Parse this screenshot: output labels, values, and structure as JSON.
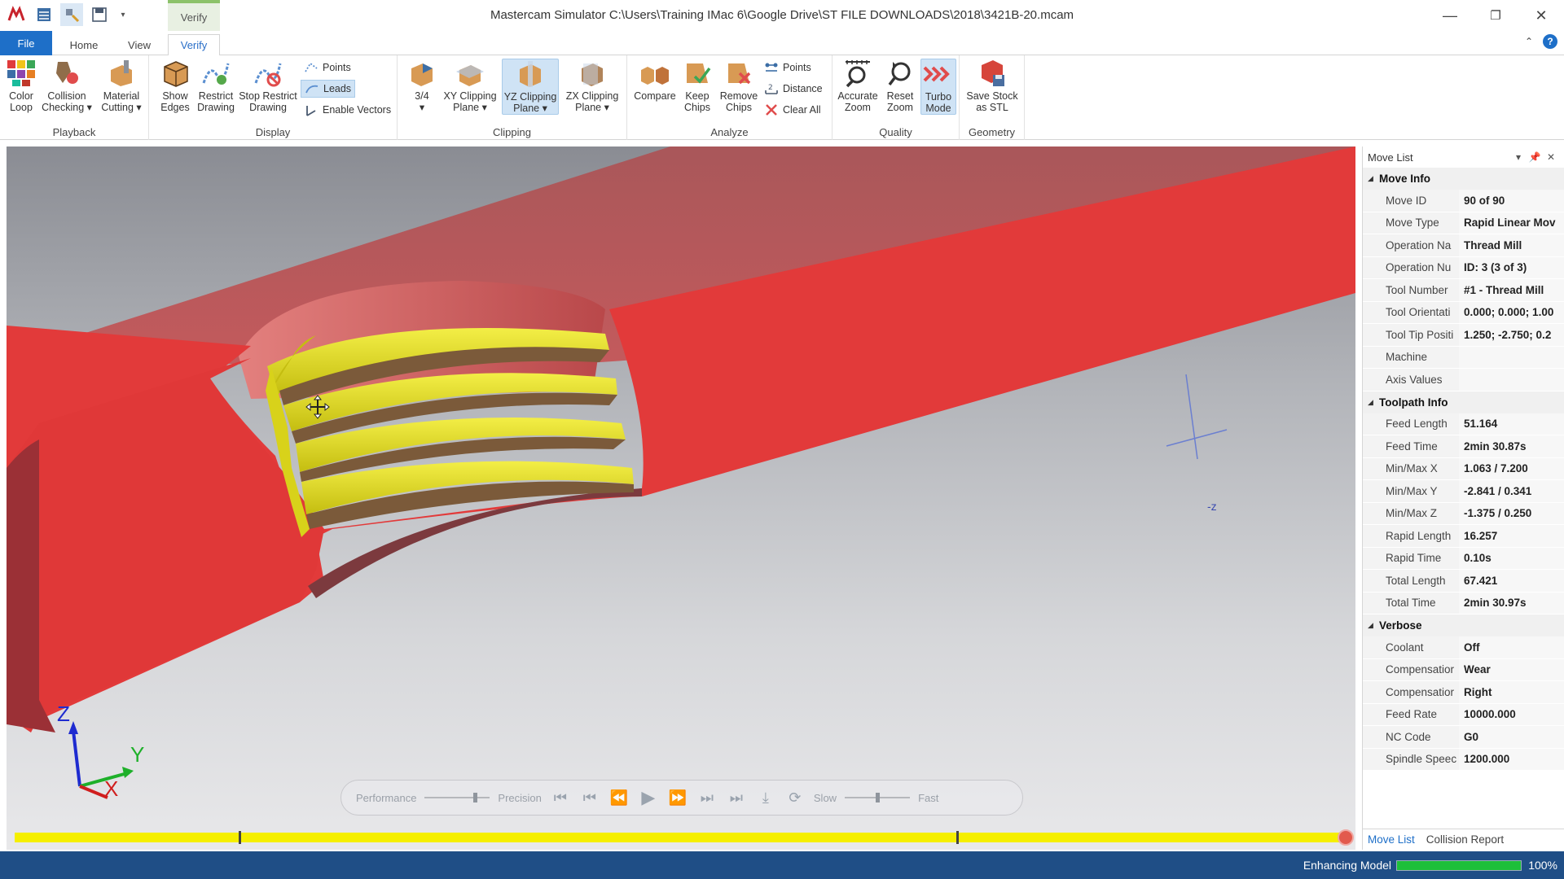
{
  "window": {
    "title": "Mastercam Simulator  C:\\Users\\Training IMac 6\\Google Drive\\ST FILE DOWNLOADS\\2018\\3421B-20.mcam",
    "context_tab": "Verify"
  },
  "tabs": {
    "file": "File",
    "home": "Home",
    "view": "View",
    "verify": "Verify"
  },
  "ribbon": {
    "playback": {
      "label": "Playback",
      "color_loop": "Color\nLoop",
      "collision": "Collision\nChecking ▾",
      "material": "Material\nCutting ▾"
    },
    "display": {
      "label": "Display",
      "show_edges": "Show\nEdges",
      "restrict": "Restrict\nDrawing",
      "stop_restrict": "Stop Restrict\nDrawing",
      "points": "Points",
      "leads": "Leads",
      "vectors": "Enable Vectors"
    },
    "clipping": {
      "label": "Clipping",
      "three_quarter": "3/4\n▾",
      "xy": "XY Clipping\nPlane ▾",
      "yz": "YZ Clipping\nPlane ▾",
      "zx": "ZX Clipping\nPlane ▾"
    },
    "analyze": {
      "label": "Analyze",
      "compare": "Compare",
      "keep": "Keep\nChips",
      "remove": "Remove\nChips",
      "points": "Points",
      "distance": "Distance",
      "clear": "Clear All"
    },
    "quality": {
      "label": "Quality",
      "accurate": "Accurate\nZoom",
      "reset": "Reset\nZoom",
      "turbo": "Turbo\nMode"
    },
    "geometry": {
      "label": "Geometry",
      "save_stl": "Save Stock\nas STL"
    }
  },
  "viewport": {
    "axis": {
      "z": "Z",
      "y": "Y",
      "x": "X"
    },
    "minus_z": "-z",
    "playbar": {
      "performance": "Performance",
      "precision": "Precision",
      "slow": "Slow",
      "fast": "Fast"
    }
  },
  "panel": {
    "title": "Move List",
    "sections": [
      {
        "name": "Move Info",
        "rows": [
          [
            "Move ID",
            "90 of 90"
          ],
          [
            "Move Type",
            "Rapid Linear Mov"
          ],
          [
            "Operation Na",
            "Thread Mill"
          ],
          [
            "Operation Nu",
            "ID: 3 (3 of 3)"
          ],
          [
            "Tool Number",
            "#1 -  Thread Mill"
          ],
          [
            "Tool Orientati",
            "0.000; 0.000; 1.00"
          ],
          [
            "Tool Tip Positi",
            "1.250; -2.750; 0.2"
          ],
          [
            "Machine",
            ""
          ],
          [
            "Axis Values",
            ""
          ]
        ]
      },
      {
        "name": "Toolpath Info",
        "rows": [
          [
            "Feed Length",
            "51.164"
          ],
          [
            "Feed Time",
            "2min 30.87s"
          ],
          [
            "Min/Max X",
            "1.063 / 7.200"
          ],
          [
            "Min/Max Y",
            "-2.841 / 0.341"
          ],
          [
            "Min/Max Z",
            "-1.375 / 0.250"
          ],
          [
            "Rapid Length",
            "16.257"
          ],
          [
            "Rapid Time",
            "0.10s"
          ],
          [
            "Total Length",
            "67.421"
          ],
          [
            "Total Time",
            "2min 30.97s"
          ]
        ]
      },
      {
        "name": "Verbose",
        "rows": [
          [
            "Coolant",
            "Off"
          ],
          [
            "Compensatior",
            "Wear"
          ],
          [
            "Compensatior",
            "Right"
          ],
          [
            "Feed Rate",
            "10000.000"
          ],
          [
            "NC Code",
            "G0"
          ],
          [
            "Spindle Speec",
            "1200.000"
          ]
        ]
      }
    ],
    "tabs": {
      "move_list": "Move List",
      "collision": "Collision Report"
    }
  },
  "status": {
    "text": "Enhancing Model",
    "progress": 100,
    "percent": "100%"
  },
  "colors": {
    "part": "#e23a3a",
    "thread": "#e8e31e",
    "accent": "#1e6fc8",
    "status_bar": "#1f4e86",
    "progress": "#1dbf3a"
  }
}
